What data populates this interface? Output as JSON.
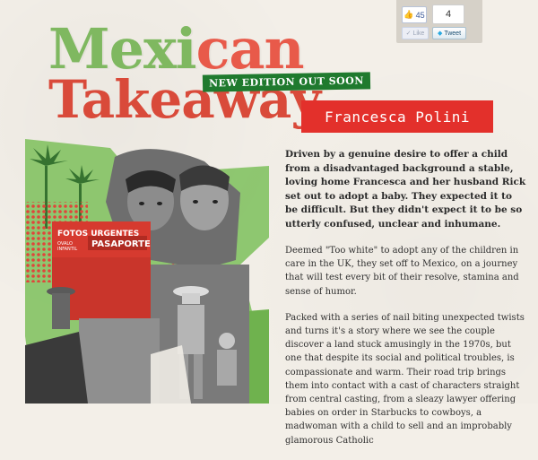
{
  "social": {
    "like_count": "45",
    "tweet_count": "4",
    "like_label": "Like",
    "tweet_label": "Tweet"
  },
  "header": {
    "title_line1": "Mexican",
    "title_line2": "Takeaway",
    "badge": "NEW EDITION OUT SOON",
    "author": "Francesca Polini"
  },
  "collage": {
    "sign1": "FOTOS URGENTES",
    "sign2": "PASAPORTE",
    "sign3": "OVALO\nINFANTIL"
  },
  "description": {
    "intro": "Driven by a genuine desire to offer a child from a disadvantaged background a stable, loving home Francesca and her husband Rick set out to adopt a baby. They expected it to be difficult. But they didn't expect it to be so utterly confused, unclear and inhumane.",
    "para1": "Deemed \"Too white\" to adopt any of the children in care in the UK, they set off to Mexico, on a journey that will test every bit of their resolve, stamina and sense of humor.",
    "para2": "Packed with a series of nail biting unexpected twists and turns it's a story where we see the couple discover a land stuck amusingly in the 1970s, but one that despite its social and political troubles, is compassionate and warm. Their road trip brings them into contact with a cast of characters straight from central casting, from a sleazy lawyer offering babies on order in Starbucks to cowboys, a madwoman with a child to sell and an improbably glamorous Catholic"
  },
  "colors": {
    "title_red": "#d94a3a",
    "title_green": "#7fb860",
    "badge_green": "#1f7a2e",
    "author_red": "#e3302b",
    "background": "#f3efe8"
  }
}
